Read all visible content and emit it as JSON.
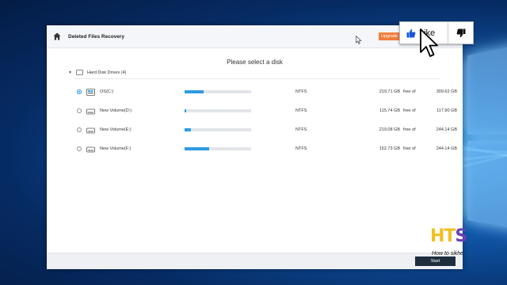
{
  "app": {
    "title": "Deleted Files Recovery",
    "upgrade_label": "Upgrade",
    "heading": "Please select a disk",
    "group_label": "Hard Disk Drives (4)",
    "start_label": "Start"
  },
  "drives": [
    {
      "name": "OS(C:)",
      "fs": "NTFS",
      "free": "219.71 GB",
      "free_of": "free of",
      "total": "309.62 GB",
      "used_fraction": 0.29,
      "selected": true,
      "icon": "os-drive-icon"
    },
    {
      "name": "New Volume(D:)",
      "fs": "NTFS",
      "free": "115.74 GB",
      "free_of": "free of",
      "total": "117.90 GB",
      "used_fraction": 0.02,
      "selected": false,
      "icon": "drive-icon"
    },
    {
      "name": "New Volume(E:)",
      "fs": "NTFS",
      "free": "219.08 GB",
      "free_of": "free of",
      "total": "244.14 GB",
      "used_fraction": 0.1,
      "selected": false,
      "icon": "drive-icon"
    },
    {
      "name": "New Volume(F:)",
      "fs": "NTFS",
      "free": "152.73 GB",
      "free_of": "free of",
      "total": "244.14 GB",
      "used_fraction": 0.37,
      "selected": false,
      "icon": "drive-icon"
    }
  ],
  "overlay": {
    "like_label": "Like",
    "watermark_letters": "HTS",
    "watermark_text": "How to sikhe"
  },
  "colors": {
    "accent": "#2f9be3",
    "upgrade": "#f07d3c",
    "start_button": "#1f2d3d",
    "like_thumb": "#1a56db"
  }
}
